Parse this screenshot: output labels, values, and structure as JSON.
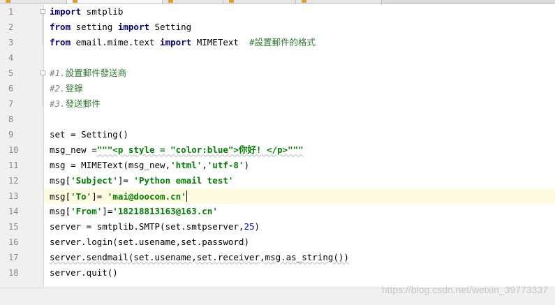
{
  "editor": {
    "line_numbers": [
      "1",
      "2",
      "3",
      "4",
      "5",
      "6",
      "7",
      "8",
      "9",
      "10",
      "11",
      "12",
      "13",
      "14",
      "15",
      "16",
      "17",
      "18"
    ],
    "current_line": 13,
    "lines": [
      [
        {
          "t": "import",
          "c": "kw"
        },
        {
          "t": " smtplib",
          "c": ""
        }
      ],
      [
        {
          "t": "from",
          "c": "kw"
        },
        {
          "t": " setting ",
          "c": ""
        },
        {
          "t": "import",
          "c": "kw"
        },
        {
          "t": " Setting",
          "c": ""
        }
      ],
      [
        {
          "t": "from",
          "c": "kw"
        },
        {
          "t": " email.mime.text ",
          "c": ""
        },
        {
          "t": "import",
          "c": "kw"
        },
        {
          "t": " MIMEText  ",
          "c": ""
        },
        {
          "t": "#設置郵件的格式",
          "c": "cmcn"
        }
      ],
      [],
      [
        {
          "t": "#1.",
          "c": "cm"
        },
        {
          "t": "設置郵件發送商",
          "c": "cmcn"
        }
      ],
      [
        {
          "t": "#2.",
          "c": "cm"
        },
        {
          "t": "登錄",
          "c": "cmcn"
        }
      ],
      [
        {
          "t": "#3.",
          "c": "cm"
        },
        {
          "t": "發送郵件",
          "c": "cmcn"
        }
      ],
      [],
      [
        {
          "t": "set = Setting()",
          "c": ""
        }
      ],
      [
        {
          "t": "msg_new =",
          "c": ""
        },
        {
          "t": "\"\"\"<p style = \"color:blue\">你好! </p>\"\"\"",
          "c": "str squiggle"
        }
      ],
      [
        {
          "t": "msg = MIMEText(msg_new,",
          "c": ""
        },
        {
          "t": "'html'",
          "c": "str"
        },
        {
          "t": ",",
          "c": ""
        },
        {
          "t": "'utf-8'",
          "c": "str"
        },
        {
          "t": ")",
          "c": ""
        }
      ],
      [
        {
          "t": "msg[",
          "c": ""
        },
        {
          "t": "'Subject'",
          "c": "str"
        },
        {
          "t": "]= ",
          "c": ""
        },
        {
          "t": "'Python email test'",
          "c": "str"
        }
      ],
      [
        {
          "t": "msg[",
          "c": ""
        },
        {
          "t": "'To'",
          "c": "str"
        },
        {
          "t": "]= ",
          "c": ""
        },
        {
          "t": "'mai@doocom.cn'",
          "c": "str"
        }
      ],
      [
        {
          "t": "msg[",
          "c": ""
        },
        {
          "t": "'From'",
          "c": "str"
        },
        {
          "t": "]=",
          "c": ""
        },
        {
          "t": "'18218813163@163.cn'",
          "c": "str"
        }
      ],
      [
        {
          "t": "server = smtplib.SMTP(set.smtpserver,",
          "c": ""
        },
        {
          "t": "25",
          "c": "num"
        },
        {
          "t": ")",
          "c": ""
        }
      ],
      [
        {
          "t": "server.login(set.usename,set.password)",
          "c": ""
        }
      ],
      [
        {
          "t": "server.sendmail(set.usename,set.receiver,msg.as_string())",
          "c": "squiggle"
        }
      ],
      [
        {
          "t": "server.quit()",
          "c": ""
        }
      ]
    ]
  },
  "watermark": "https://blog.csdn.net/weixin_39773337",
  "colors": {
    "keyword": "#000080",
    "string": "#008000",
    "comment": "#808080",
    "number": "#0000ff",
    "current_line": "#fffbe0"
  }
}
